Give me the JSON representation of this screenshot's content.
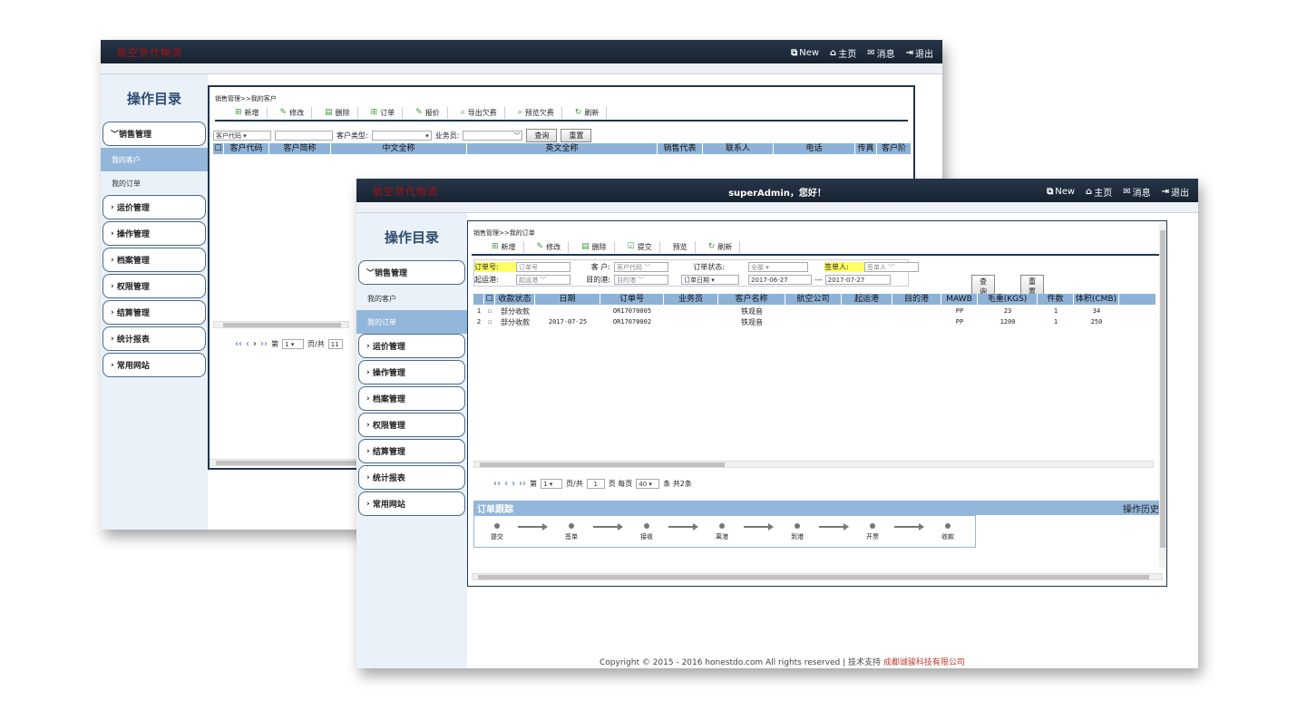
{
  "back": {
    "logo": "航空货代物流",
    "nav": {
      "new": "New",
      "home": "主页",
      "msg": "消息",
      "logout": "退出"
    },
    "sidebar": {
      "title": "操作目录",
      "menus": [
        "销售管理",
        "运价管理",
        "操作管理",
        "档案管理",
        "权限管理",
        "结算管理",
        "统计报表",
        "常用网站"
      ],
      "subs": [
        "我的客户",
        "我的订单"
      ]
    },
    "breadcrumb": "销售管理>>我的客户",
    "toolbar": [
      "新增",
      "修改",
      "删除",
      "订单",
      "报价",
      "导出欠费",
      "预览欠费",
      "刷新"
    ],
    "filter": {
      "code_select": "客户代码",
      "type_label": "客户类型:",
      "sales_label": "业务员:",
      "query": "查询",
      "reset": "重置"
    },
    "headers": [
      "客户代码",
      "客户简称",
      "中文全称",
      "英文全称",
      "销售代表",
      "联系人",
      "电话",
      "传真",
      "客户阶"
    ],
    "pager": {
      "page_label": "第",
      "page": "1",
      "total_label": "页/共",
      "total": "11"
    }
  },
  "front": {
    "logo": "航空货代物流",
    "greeting": "superAdmin，您好！",
    "nav": {
      "new": "New",
      "home": "主页",
      "msg": "消息",
      "logout": "退出"
    },
    "sidebar": {
      "title": "操作目录",
      "menus": [
        "销售管理",
        "运价管理",
        "操作管理",
        "档案管理",
        "权限管理",
        "结算管理",
        "统计报表",
        "常用网站"
      ],
      "subs": [
        "我的客户",
        "我的订单"
      ]
    },
    "breadcrumb": "销售管理>>我的订单",
    "toolbar": [
      "新增",
      "修改",
      "删除",
      "提交",
      "预览",
      "刷新"
    ],
    "filter": {
      "order_no_label": "订单号:",
      "order_no_ph": "订单号",
      "customer_label": "客  户:",
      "customer_ph": "客户代码",
      "status_label": "订单状态:",
      "status_value": "全部",
      "signer_label": "签单人:",
      "signer_ph": "签单人",
      "origin_label": "起运港:",
      "origin_ph": "起运港",
      "dest_label": "目的港:",
      "dest_ph": "目的港",
      "date_type": "订单日期",
      "date_from": "2017-06-27",
      "date_sep": "---",
      "date_to": "2017-07-27",
      "query": "查询",
      "reset": "重置"
    },
    "headers": [
      "收款状态",
      "日期",
      "订单号",
      "业务员",
      "客户名称",
      "航空公司",
      "起运港",
      "目的港",
      "MAWB",
      "毛重(KGS)",
      "件数",
      "体积(CMB)"
    ],
    "rows": [
      {
        "n": "1",
        "status": "部分收款",
        "date": "",
        "order": "OR17070005",
        "sales": "",
        "customer": "铁观音",
        "airline": "",
        "origin": "",
        "dest": "",
        "mawb": "PP",
        "weight": "23",
        "pieces": "1",
        "volume": "34"
      },
      {
        "n": "2",
        "status": "部分收款",
        "date": "2017-07-25",
        "order": "OR17070002",
        "sales": "",
        "customer": "铁观音",
        "airline": "",
        "origin": "",
        "dest": "",
        "mawb": "PP",
        "weight": "1200",
        "pieces": "1",
        "volume": "250"
      }
    ],
    "pager": {
      "page_label": "第",
      "page": "1",
      "total_label": "页/共",
      "total": "1",
      "per_label": "页 每页",
      "per": "40",
      "count": "条 共2条"
    },
    "tracking": {
      "title": "订单跟踪",
      "history": "操作历史",
      "steps": [
        "提交",
        "签单",
        "接收",
        "离港",
        "到港",
        "开票",
        "收款"
      ]
    },
    "copyright": "Copyright © 2015 - 2016 honestdo.com All rights reserved | 技术支持 ",
    "company": "成都诚骏科技有限公司"
  }
}
